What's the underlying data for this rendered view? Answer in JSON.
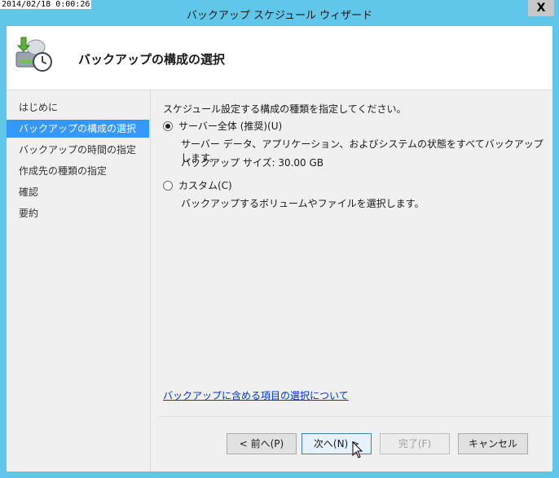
{
  "overlay": {
    "timestamp": "2014/02/18 0:00:26"
  },
  "window": {
    "title": "バックアップ スケジュール ウィザード",
    "close_label": "X"
  },
  "header": {
    "title": "バックアップの構成の選択"
  },
  "sidebar": {
    "items": [
      {
        "label": "はじめに",
        "selected": false
      },
      {
        "label": "バックアップの構成の選択",
        "selected": true
      },
      {
        "label": "バックアップの時間の指定",
        "selected": false
      },
      {
        "label": "作成先の種類の指定",
        "selected": false
      },
      {
        "label": "確認",
        "selected": false
      },
      {
        "label": "要約",
        "selected": false
      }
    ]
  },
  "main": {
    "instruction": "スケジュール設定する構成の種類を指定してください。",
    "options": [
      {
        "label": "サーバー全体 (推奨)(U)",
        "checked": true,
        "description": "サーバー データ、アプリケーション、およびシステムの状態をすべてバックアップします。",
        "size_text": "バックアップ サイズ: 30.00 GB"
      },
      {
        "label": "カスタム(C)",
        "checked": false,
        "description": "バックアップするボリュームやファイルを選択します。"
      }
    ],
    "link": "バックアップに含める項目の選択について"
  },
  "buttons": {
    "back": "< 前へ(P)",
    "next": "次へ(N) >",
    "finish": "完了(F)",
    "cancel": "キャンセル"
  }
}
